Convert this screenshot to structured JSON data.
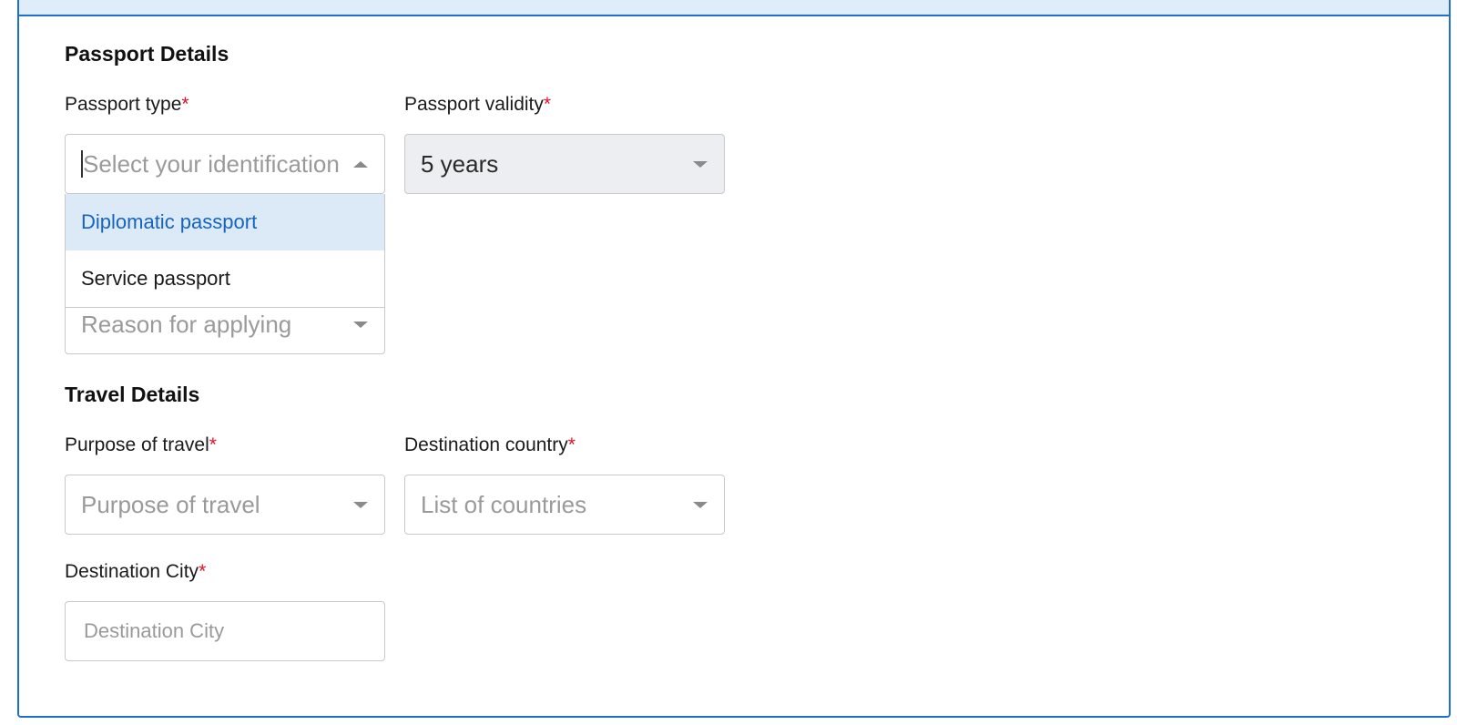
{
  "passport_section": {
    "title": "Passport Details",
    "passport_type": {
      "label": "Passport type",
      "required_mark": "*",
      "placeholder": "Select your identification",
      "options": [
        "Diplomatic passport",
        "Service passport"
      ],
      "highlighted_option": "Diplomatic passport"
    },
    "passport_validity": {
      "label": "Passport validity",
      "required_mark": "*",
      "value": "5 years"
    },
    "reason": {
      "placeholder": "Reason for applying"
    }
  },
  "travel_section": {
    "title": "Travel Details",
    "purpose": {
      "label": "Purpose of travel",
      "required_mark": "*",
      "placeholder": "Purpose of travel"
    },
    "destination_country": {
      "label": "Destination country",
      "required_mark": "*",
      "placeholder": "List of countries"
    },
    "destination_city": {
      "label": "Destination City",
      "required_mark": "*",
      "placeholder": "Destination City"
    }
  },
  "colors": {
    "accent": "#1f6fcf",
    "required": "#e0102a",
    "highlight_bg": "#dceaf8",
    "highlight_text": "#1565c0"
  },
  "icons": {
    "caret_down": "chevron-down-icon",
    "caret_up": "chevron-up-icon"
  }
}
